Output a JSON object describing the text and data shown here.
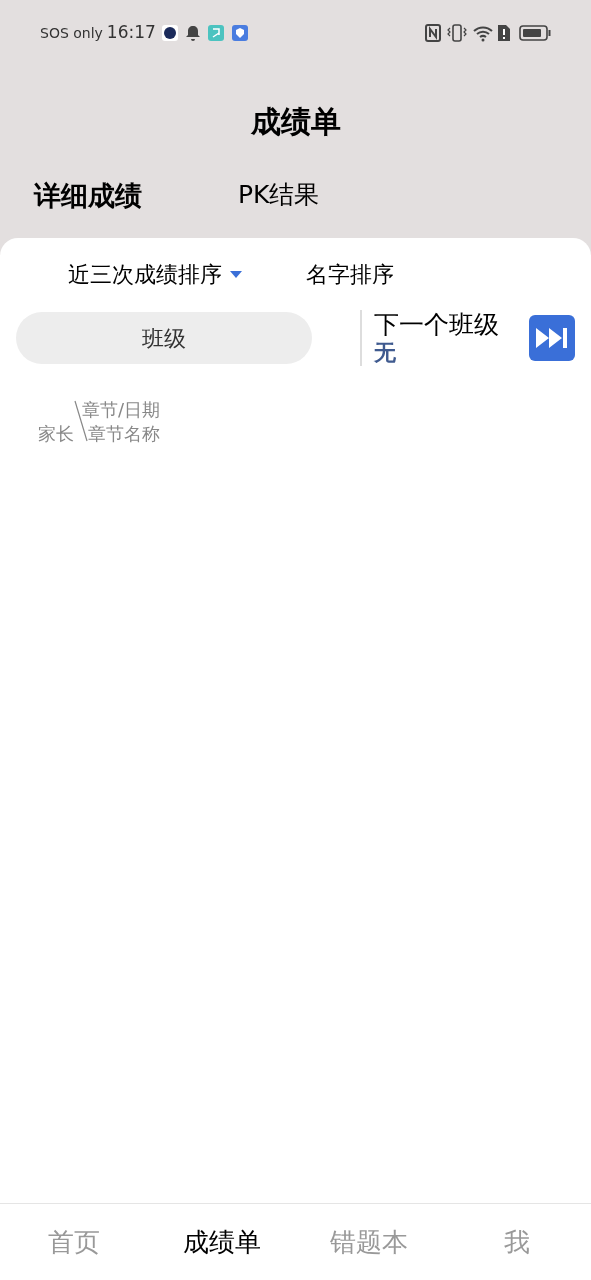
{
  "status_bar": {
    "carrier": "SOS only",
    "time": "16:17"
  },
  "title": "成绩单",
  "tabs": [
    {
      "label": "详细成绩",
      "selected": true
    },
    {
      "label": "PK结果",
      "selected": false
    }
  ],
  "sort_options": [
    {
      "label": "近三次成绩排序",
      "dropdown": true
    },
    {
      "label": "名字排序",
      "dropdown": false
    }
  ],
  "class_field": {
    "placeholder": "班级"
  },
  "next_class": {
    "label": "下一个班级",
    "value": "无"
  },
  "table_header": {
    "row_label": "家长",
    "column_top": "章节/日期",
    "column_bottom": "章节名称"
  },
  "bottom_nav": [
    {
      "label": "首页",
      "selected": false
    },
    {
      "label": "成绩单",
      "selected": true
    },
    {
      "label": "错题本",
      "selected": false
    },
    {
      "label": "我",
      "selected": false
    }
  ]
}
